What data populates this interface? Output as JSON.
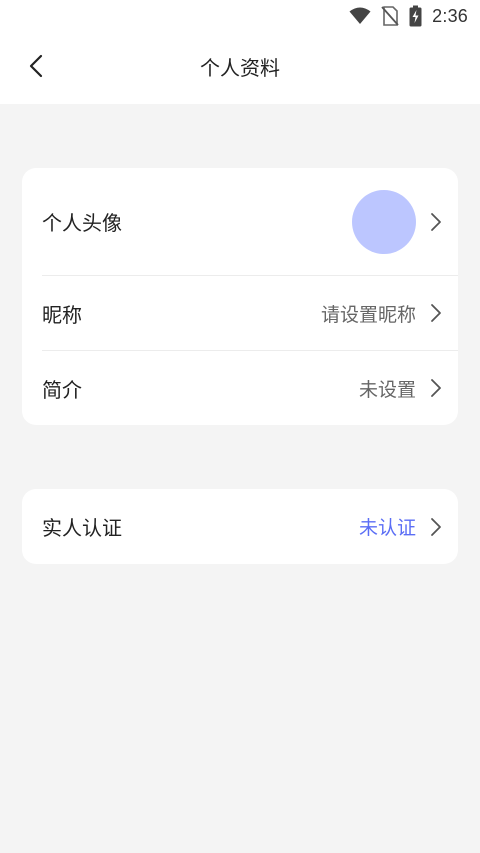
{
  "status_bar": {
    "time": "2:36",
    "icons": [
      "wifi-icon",
      "no-sim-icon",
      "battery-charging-icon"
    ]
  },
  "header": {
    "back_icon": "chevron-left-icon",
    "title": "个人资料"
  },
  "profile_card": {
    "avatar_row": {
      "label": "个人头像",
      "avatar_color": "#bcc6ff"
    },
    "nickname_row": {
      "label": "昵称",
      "value": "请设置昵称"
    },
    "bio_row": {
      "label": "简介",
      "value": "未设置"
    }
  },
  "verify_card": {
    "row": {
      "label": "实人认证",
      "value": "未认证",
      "value_color": "#5b6ef5"
    }
  },
  "colors": {
    "background": "#f4f4f4",
    "card": "#ffffff",
    "accent": "#5b6ef5",
    "avatar": "#bcc6ff"
  }
}
